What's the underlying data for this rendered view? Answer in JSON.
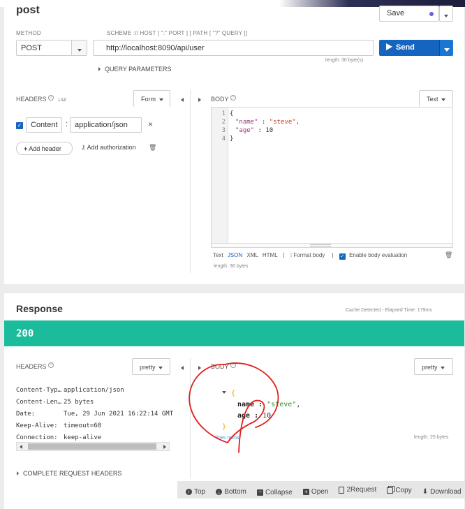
{
  "request": {
    "name": "post",
    "save_label": "Save",
    "method_label": "METHOD",
    "method_value": "POST",
    "url_label": "SCHEME :// HOST [ \":\" PORT ] [ PATH [ \"?\" QUERY ]]",
    "url_value": "http://localhost:8090/api/user",
    "send_label": "Send",
    "url_length": "length: 30 byte(s)",
    "query_params_label": "QUERY PARAMETERS"
  },
  "headers": {
    "title": "HEADERS",
    "help": "?",
    "sort_icon": "↓A​Z",
    "mode": "Form",
    "items": [
      {
        "enabled": true,
        "name": "Content",
        "separator": ":",
        "value": "application/json",
        "remove": "×"
      }
    ],
    "add_header_label": "Add header",
    "add_auth_label": "Add authorization"
  },
  "body": {
    "title": "BODY",
    "help": "?",
    "mode": "Text",
    "lines": [
      {
        "n": "1",
        "text": "{"
      },
      {
        "n": "2",
        "key": "\"name\"",
        "sep": " : ",
        "val": "\"steve\"",
        "end": ","
      },
      {
        "n": "3",
        "key": "\"age\"",
        "sep": " : ",
        "num": "10",
        "end": ""
      },
      {
        "n": "4",
        "text": "}"
      }
    ],
    "formats": [
      "Text",
      "JSON",
      "XML",
      "HTML"
    ],
    "active_format": "JSON",
    "divider": "|",
    "format_body_label": "Format body",
    "enable_eval_label": "Enable body evaluation",
    "length": "length: 36 bytes"
  },
  "response": {
    "title": "Response",
    "cache_text": "Cache Detected - Elapsed Time: 179ms",
    "status": "200",
    "status_color": "#1abc9c",
    "headers_title": "HEADERS",
    "headers_mode": "pretty",
    "headers": [
      {
        "k": "Content-Typ…",
        "v": "application/json"
      },
      {
        "k": "Content-Len…",
        "v": "25 bytes"
      },
      {
        "k": "Date:",
        "v": "Tue, 29 Jun 2021 16:22:14 GMT"
      },
      {
        "k": "Keep-Alive:",
        "v": "timeout=60"
      },
      {
        "k": "Connection:",
        "v": "keep-alive"
      }
    ],
    "complete_headers_label": "COMPLETE REQUEST HEADERS",
    "body_title": "BODY",
    "body_mode": "pretty",
    "json_open": "{",
    "json_close": "}",
    "json_lines": [
      {
        "key": "name :",
        "val": "\"steve\"",
        "end": ","
      },
      {
        "key": "age :",
        "val": "10",
        "end": ""
      }
    ],
    "lines_label": "lines nums",
    "length": "length: 25 bytes"
  },
  "toolbar": {
    "items": [
      "Top",
      "Bottom",
      "Collapse",
      "Open",
      "2Request",
      "Copy",
      "Download"
    ]
  },
  "colors": {
    "send": "#1565c0",
    "teal": "#1abc9c",
    "annotation": "#e0201b"
  }
}
